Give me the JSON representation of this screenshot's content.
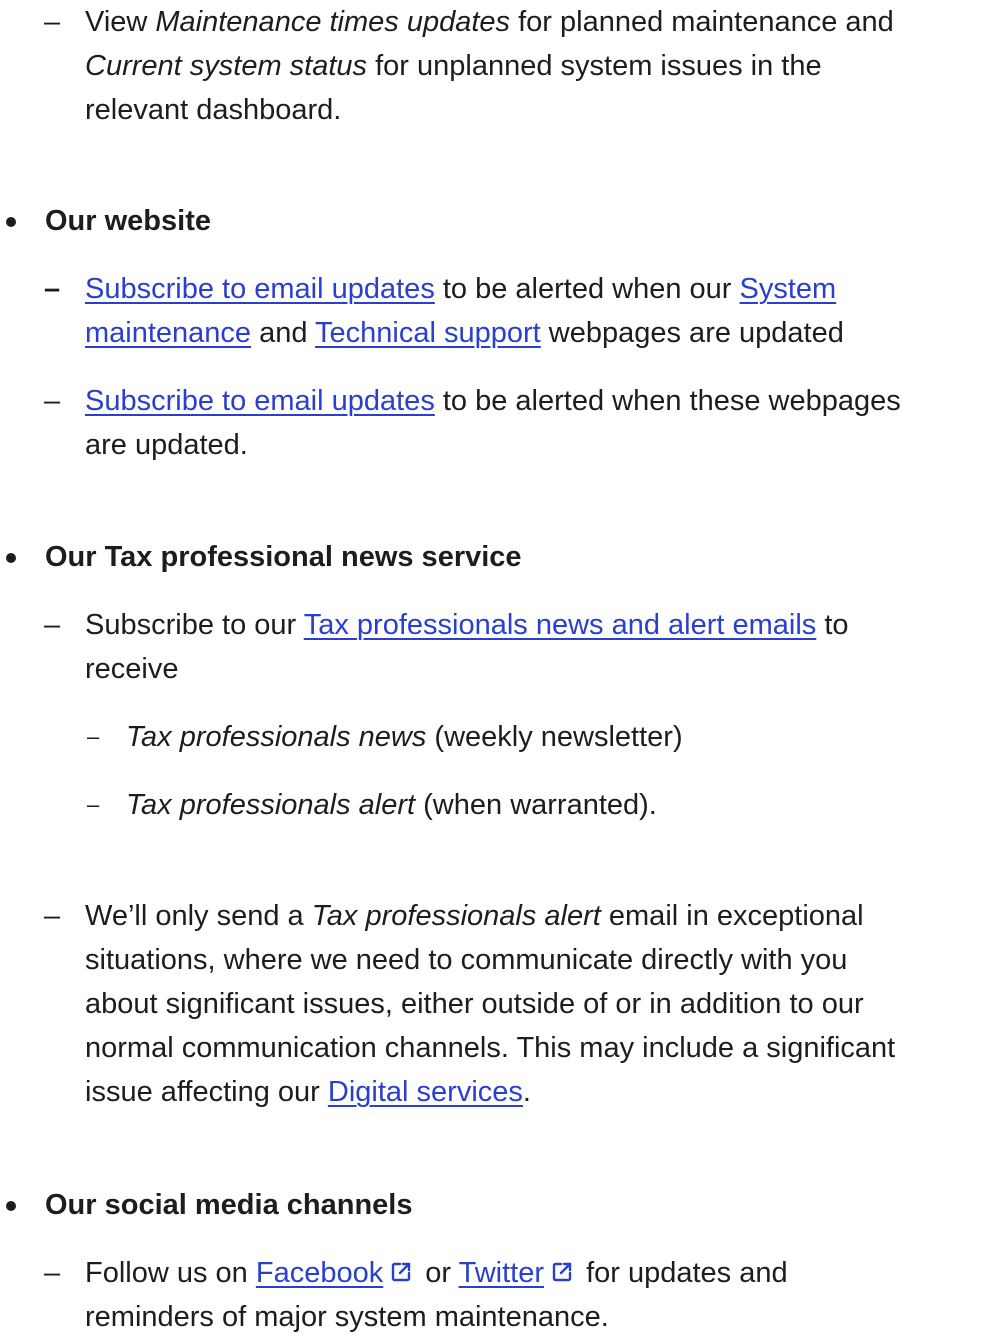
{
  "section_status": {
    "item_view": {
      "prefix": "View ",
      "emph1": "Maintenance times updates",
      "mid": " for planned maintenance and",
      "emph2": "Current system status",
      "rest1": " for unplanned system issues in the",
      "rest2": "relevant dashboard."
    }
  },
  "section_website": {
    "heading": "Our website",
    "item1": {
      "link1": "Subscribe to email updates",
      "text1": " to be alerted when our ",
      "link2a": "System",
      "link2b": "maintenance",
      "text2": " and ",
      "link3": "Technical support",
      "text3": " webpages are updated"
    },
    "item2": {
      "link1": "Subscribe to email updates",
      "text1": " to be alerted when these webpages",
      "text2": "are updated."
    }
  },
  "section_news": {
    "heading": "Our Tax professional news service",
    "item1": {
      "prefix": "Subscribe to our ",
      "link": "Tax professionals news and alert emails",
      "suffix": " to",
      "line2": "receive",
      "sub1_emph": "Tax professionals news",
      "sub1_rest": " (weekly newsletter)",
      "sub2_emph": "Tax professionals alert",
      "sub2_rest": " (when warranted)."
    },
    "item2": {
      "prefix": "We’ll only send a ",
      "emph": "Tax professionals alert",
      "rest1": " email in exceptional",
      "line2": "situations, where we need to communicate directly with you",
      "line3": "about significant issues, either outside of or in addition to our",
      "line4": "normal communication channels. This may include a significant",
      "line5_prefix": "issue affecting our ",
      "line5_link": "Digital services",
      "line5_suffix": "."
    }
  },
  "section_social": {
    "heading": "Our social media channels",
    "item1": {
      "prefix": "Follow us on ",
      "link1": "Facebook",
      "mid": " or ",
      "link2": "Twitter",
      "rest": " for updates and",
      "line2": "reminders of major system maintenance."
    },
    "icons": {
      "external_link": "external-link-icon"
    }
  },
  "colors": {
    "link": "#2a3ecf",
    "text": "#1d1d1f"
  }
}
